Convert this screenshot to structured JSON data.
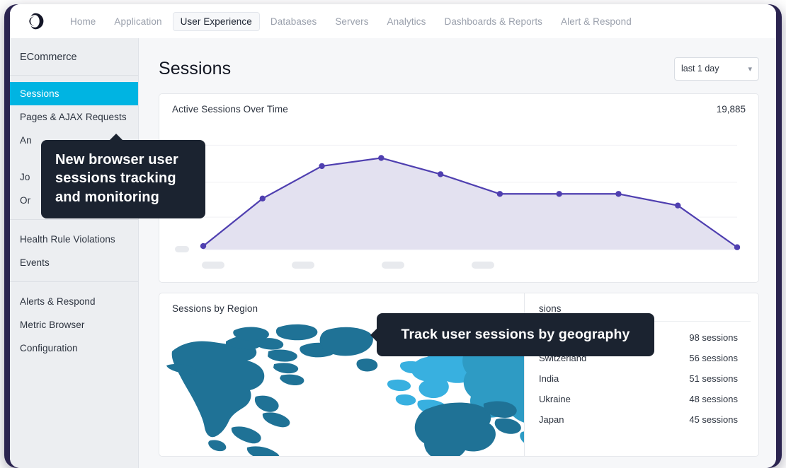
{
  "colors": {
    "frame": "#2b2450",
    "accent_sidebar_active": "#00b4e2",
    "chart_line": "#4f3fb0",
    "chart_fill": "#e3e1f0",
    "map_dark": "#1f7296",
    "map_mid": "#2e9bc4",
    "map_light": "#38b0e0",
    "tooltip_bg": "#1b2330"
  },
  "topnav": {
    "logo_icon": "appdynamics-logo-icon",
    "items": [
      {
        "label": "Home",
        "active": false
      },
      {
        "label": "Application",
        "active": false
      },
      {
        "label": "User Experience",
        "active": true
      },
      {
        "label": "Databases",
        "active": false
      },
      {
        "label": "Servers",
        "active": false
      },
      {
        "label": "Analytics",
        "active": false
      },
      {
        "label": "Dashboards & Reports",
        "active": false
      },
      {
        "label": "Alert & Respond",
        "active": false
      }
    ]
  },
  "sidebar": {
    "app_title": "ECommerce",
    "group1": [
      {
        "label": "Sessions",
        "active": true
      },
      {
        "label": "Pages & AJAX Requests",
        "active": false
      },
      {
        "label": "An",
        "active": false
      },
      {
        "label": "Jo",
        "active": false
      },
      {
        "label": "Or",
        "active": false
      }
    ],
    "group2": [
      {
        "label": "Health Rule Violations",
        "active": false
      },
      {
        "label": "Events",
        "active": false
      }
    ],
    "group3": [
      {
        "label": "Alerts & Respond",
        "active": false
      },
      {
        "label": "Metric Browser",
        "active": false
      },
      {
        "label": "Configuration",
        "active": false
      }
    ]
  },
  "page": {
    "title": "Sessions",
    "time_range": {
      "value": "last 1 day",
      "chevron_icon": "chevron-down-icon"
    }
  },
  "chart_card": {
    "title": "Active Sessions Over Time",
    "metric": "19,885"
  },
  "chart_data": {
    "type": "area",
    "title": "Active Sessions Over Time",
    "xlabel": "",
    "ylabel": "",
    "grid": true,
    "legend": false,
    "axis_labels_masked": true,
    "x_tick_count": 4,
    "y_tick_count": 1,
    "ylim": [
      0,
      100
    ],
    "x": [
      0,
      1,
      2,
      3,
      4,
      5,
      6,
      7,
      8,
      9
    ],
    "values": [
      3,
      44,
      72,
      79,
      65,
      48,
      48,
      48,
      38,
      2
    ]
  },
  "region_card": {
    "map_title": "Sessions by Region",
    "map_icon": "world-map-icon",
    "table_title_visible": "sions",
    "table_rows": [
      {
        "country": "",
        "sessions": "98 sessions"
      },
      {
        "country": "Switzerland",
        "sessions": "56 sessions"
      },
      {
        "country": "India",
        "sessions": "51 sessions"
      },
      {
        "country": "Ukraine",
        "sessions": "48 sessions"
      },
      {
        "country": "Japan",
        "sessions": "45 sessions"
      }
    ]
  },
  "tooltips": {
    "one": "New browser user sessions tracking and monitoring",
    "two": "Track user sessions by geography"
  }
}
